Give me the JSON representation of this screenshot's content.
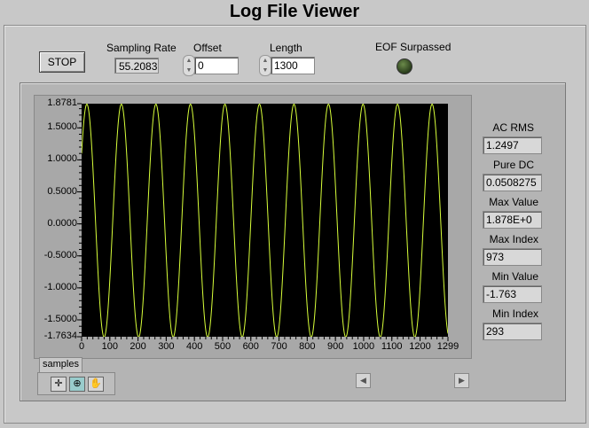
{
  "window": {
    "title": "Log File Viewer"
  },
  "controls": {
    "stop_label": "STOP",
    "sampling_rate_label": "Sampling Rate",
    "sampling_rate_value": "55.2083",
    "offset_label": "Offset",
    "offset_value": "0",
    "length_label": "Length",
    "length_value": "1300",
    "eof_label": "EOF Surpassed"
  },
  "stats": {
    "ac_rms_label": "AC RMS",
    "ac_rms": "1.2497",
    "pure_dc_label": "Pure DC",
    "pure_dc": "0.0508275",
    "max_value_label": "Max Value",
    "max_value": "1.878E+0",
    "max_index_label": "Max Index",
    "max_index": "973",
    "min_value_label": "Min Value",
    "min_value": "-1.763",
    "min_index_label": "Min Index",
    "min_index": "293"
  },
  "graph": {
    "x_axis_label": "samples",
    "y_ticks": [
      "1.8781",
      "1.5000",
      "1.0000",
      "0.5000",
      "0.0000",
      "-0.5000",
      "-1.0000",
      "-1.5000",
      "-1.7634"
    ],
    "x_ticks": [
      "0",
      "100",
      "200",
      "300",
      "400",
      "500",
      "600",
      "700",
      "800",
      "900",
      "1000",
      "1100",
      "1200",
      "1299"
    ]
  },
  "colors": {
    "trace": "#d8ff3a",
    "plot_bg": "#000000",
    "panel_bg": "#c8c8c8"
  },
  "chart_data": {
    "type": "line",
    "xlabel": "samples",
    "xlim": [
      0,
      1299
    ],
    "ylim": [
      -1.7634,
      1.8781
    ],
    "series": [
      {
        "amplitude": 1.82,
        "offset": 0.0508275,
        "period": 122.4,
        "phase_sample": 0,
        "start_value": 1.1
      }
    ],
    "n_points": 1300
  }
}
